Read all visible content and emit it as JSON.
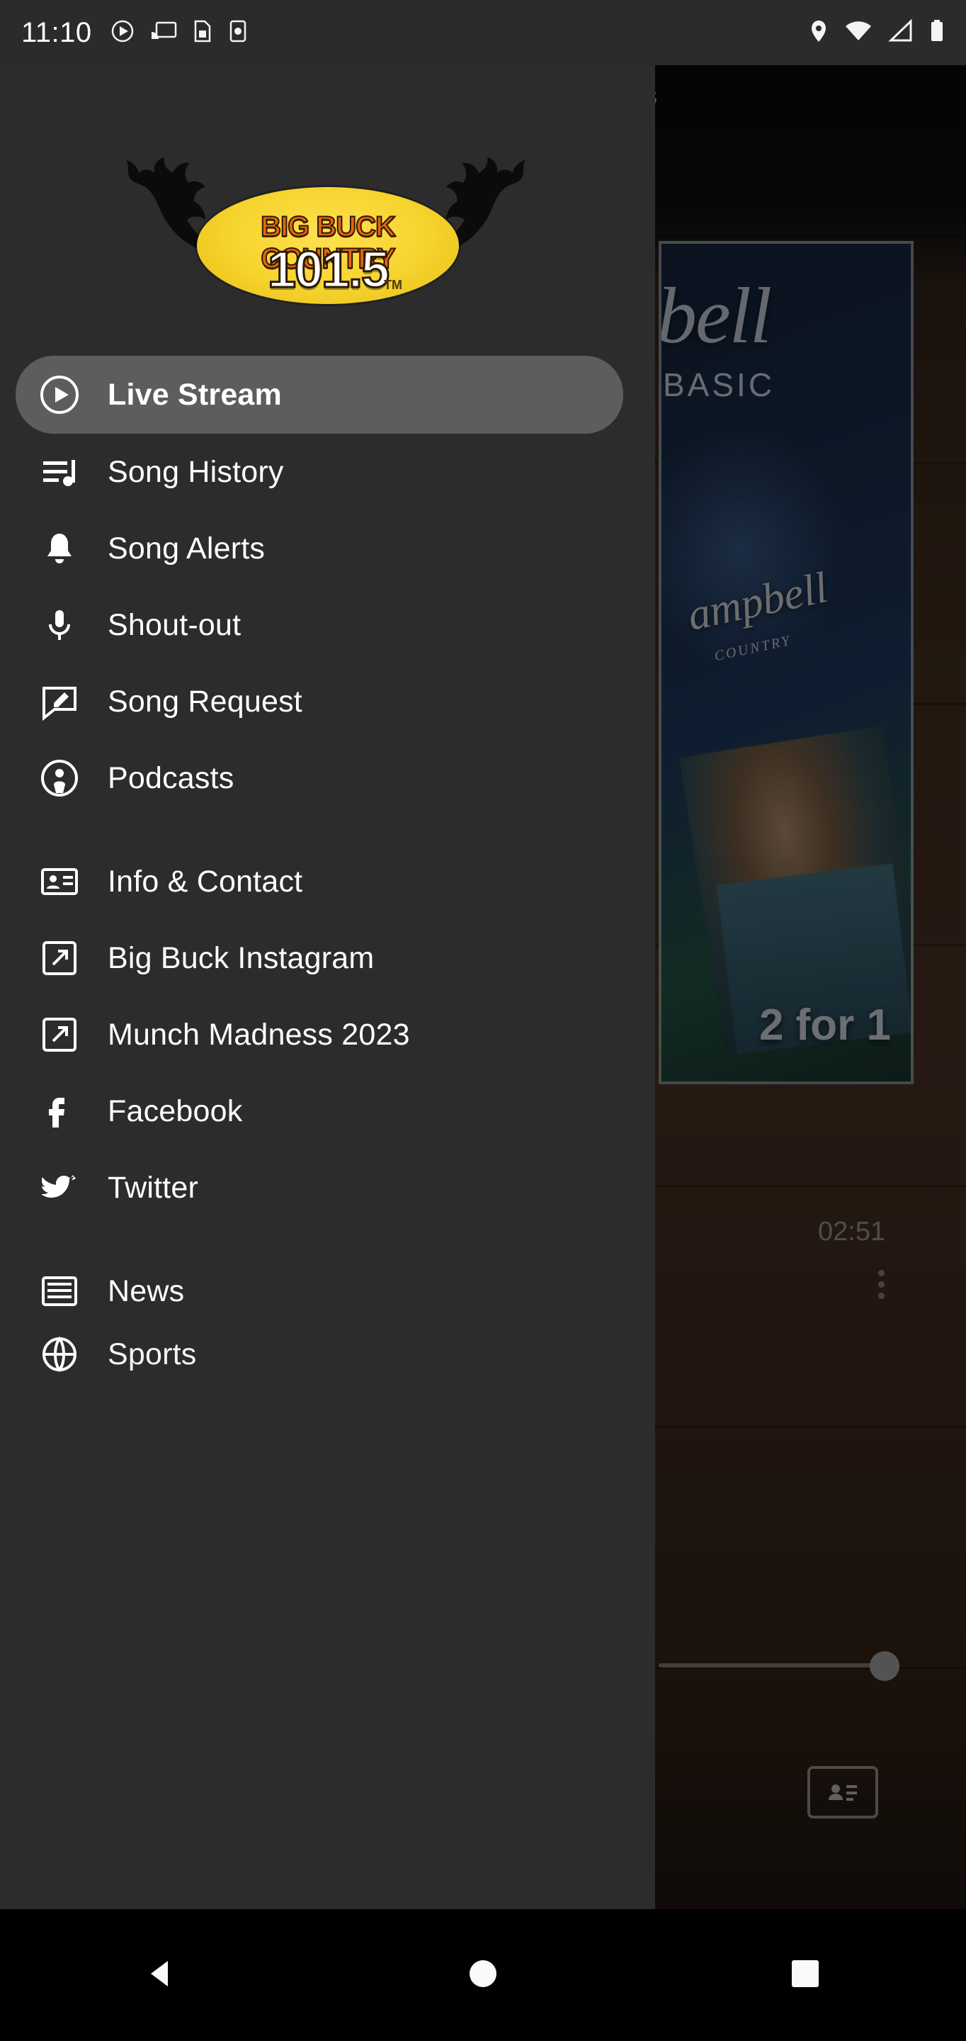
{
  "status_bar": {
    "clock": "11:10",
    "left_icons": [
      "play-circle-icon",
      "cast-icon",
      "sim-card-icon",
      "screen-record-icon"
    ],
    "right_icons": [
      "location-icon",
      "wifi-icon",
      "cell-signal-icon",
      "battery-icon"
    ]
  },
  "drawer": {
    "logo": {
      "brand_line": "BIG BUCK COUNTRY",
      "frequency": "101.5",
      "trademark": "TM"
    },
    "items": [
      {
        "label": "Live Stream",
        "icon": "play-circle-icon",
        "active": true
      },
      {
        "label": "Song History",
        "icon": "playlist-icon",
        "active": false
      },
      {
        "label": "Song Alerts",
        "icon": "bell-icon",
        "active": false
      },
      {
        "label": "Shout-out",
        "icon": "microphone-icon",
        "active": false
      },
      {
        "label": "Song Request",
        "icon": "chat-edit-icon",
        "active": false
      },
      {
        "label": "Podcasts",
        "icon": "podcast-icon",
        "active": false
      },
      {
        "label": "Info & Contact",
        "icon": "contact-card-icon",
        "active": false
      },
      {
        "label": "Big Buck Instagram",
        "icon": "external-link-icon",
        "active": false
      },
      {
        "label": "Munch Madness 2023",
        "icon": "external-link-icon",
        "active": false
      },
      {
        "label": "Facebook",
        "icon": "facebook-icon",
        "active": false
      },
      {
        "label": "Twitter",
        "icon": "twitter-icon",
        "active": false
      },
      {
        "label": "News",
        "icon": "list-icon",
        "active": false
      },
      {
        "label": "Sports",
        "icon": "megaphone-icon",
        "active": false
      }
    ]
  },
  "player": {
    "topbar_title_partial": "s",
    "album_art": {
      "artist_partial": "bell",
      "subtitle_partial": "BASIC",
      "script_partial": "ampbell",
      "script_small": "COUNTRY",
      "promo_badge": "2 for 1"
    },
    "elapsed_time": "02:51",
    "overflow_icon": "kebab-menu-icon",
    "seek_position_percent": 93,
    "contact_icon": "contact-card-icon"
  },
  "nav_bar": {
    "back": "back-triangle-icon",
    "home": "home-circle-icon",
    "recents": "recents-square-icon"
  },
  "colors": {
    "drawer_bg": "#2c2c2c",
    "status_bg": "#2b2b2b",
    "active_item_bg": "#5d5d5d",
    "logo_yellow": "#f6d32d",
    "logo_orange": "#e8640f",
    "text_primary": "#ffffff",
    "nav_bg": "#000000"
  }
}
